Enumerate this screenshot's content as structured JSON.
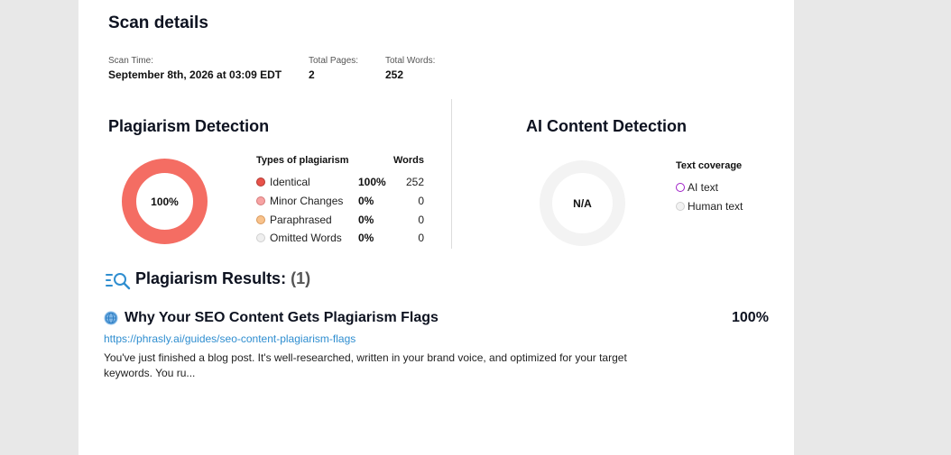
{
  "scan": {
    "title": "Scan details",
    "scan_time_label": "Scan Time:",
    "scan_time_value": "September 8th, 2026 at 03:09 EDT",
    "total_pages_label": "Total Pages:",
    "total_pages_value": "2",
    "total_words_label": "Total Words:",
    "total_words_value": "252"
  },
  "plagiarism": {
    "title": "Plagiarism Detection",
    "donut_label": "100%",
    "donut_color": "#f46d63",
    "col_types": "Types of plagiarism",
    "col_words": "Words",
    "rows": [
      {
        "label": "Identical",
        "pct": "100%",
        "words": "252",
        "color": "#e8524a",
        "border": "#b23a33"
      },
      {
        "label": "Minor Changes",
        "pct": "0%",
        "words": "0",
        "color": "#f7a3a3",
        "border": "#d67a7a"
      },
      {
        "label": "Paraphrased",
        "pct": "0%",
        "words": "0",
        "color": "#f8c28c",
        "border": "#d9995a"
      },
      {
        "label": "Omitted Words",
        "pct": "0%",
        "words": "0",
        "color": "#efefef",
        "border": "#cfcfcf"
      }
    ]
  },
  "ai": {
    "title": "AI Content Detection",
    "donut_label": "N/A",
    "coverage_title": "Text coverage",
    "ai_text_label": "AI text",
    "human_text_label": "Human text",
    "ai_color": "#a020c8"
  },
  "results": {
    "title": "Plagiarism Results:",
    "count": "(1)",
    "items": [
      {
        "title": "Why Your SEO Content Gets Plagiarism Flags",
        "score": "100%",
        "url": "https://phrasly.ai/guides/seo-content-plagiarism-flags",
        "snippet": "You've just finished a blog post. It's well-researched, written in your brand voice, and optimized for your target keywords. You ru..."
      }
    ]
  }
}
